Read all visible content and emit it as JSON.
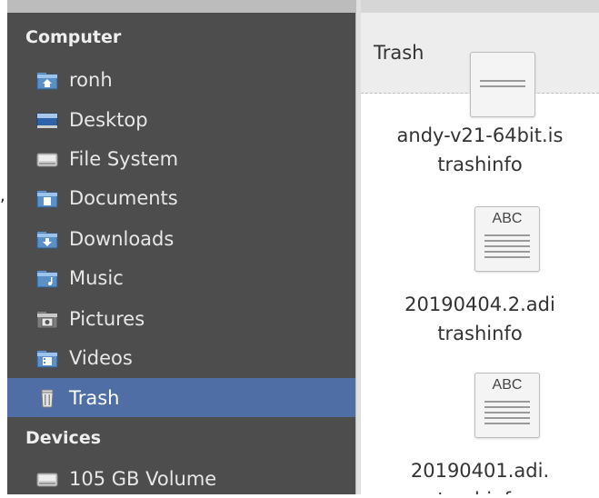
{
  "sidebar": {
    "sections": [
      {
        "header": "Computer",
        "items": [
          {
            "label": "ronh",
            "icon": "home-folder-icon"
          },
          {
            "label": "Desktop",
            "icon": "desktop-icon"
          },
          {
            "label": "File System",
            "icon": "drive-icon"
          },
          {
            "label": "Documents",
            "icon": "documents-folder-icon"
          },
          {
            "label": "Downloads",
            "icon": "downloads-folder-icon"
          },
          {
            "label": "Music",
            "icon": "music-folder-icon"
          },
          {
            "label": "Pictures",
            "icon": "pictures-folder-icon"
          },
          {
            "label": "Videos",
            "icon": "videos-folder-icon"
          },
          {
            "label": "Trash",
            "icon": "trash-icon",
            "selected": true
          }
        ]
      },
      {
        "header": "Devices",
        "items": [
          {
            "label": "105 GB Volume",
            "icon": "drive-icon"
          }
        ]
      }
    ]
  },
  "stray_mark": ",",
  "location": {
    "title": "Trash"
  },
  "files": [
    {
      "name_line1": "andy-v21-64bit.is",
      "name_line2": "trashinfo",
      "thumb_text": ""
    },
    {
      "name_line1": "20190404.2.adi",
      "name_line2": "trashinfo",
      "thumb_text": "ABC"
    },
    {
      "name_line1": "20190401.adi.",
      "name_line2": "trashinfo",
      "thumb_text": "ABC"
    }
  ],
  "colors": {
    "sidebar_bg": "#4d4d4d",
    "selected_bg": "#4f6ea5",
    "folder_blue": "#5b8fc7"
  }
}
